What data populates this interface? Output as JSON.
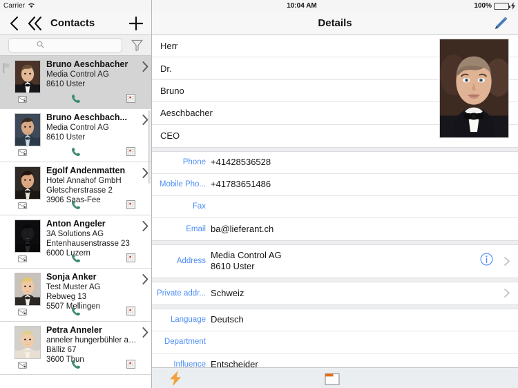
{
  "status_bar": {
    "carrier": "Carrier",
    "wifi_icon": "wifi-icon",
    "time": "10:04 AM",
    "battery_percent": "100%",
    "battery_icon": "battery-charging-icon",
    "battery_color": "#4cd964"
  },
  "left_pane": {
    "nav": {
      "back_icon": "chevron-left-icon",
      "back_all_icon": "chevron-double-left-icon",
      "title": "Contacts",
      "add_icon": "plus-icon"
    },
    "search": {
      "placeholder": "",
      "value": "",
      "search_icon": "search-icon",
      "filter_icon": "filter-funnel-icon"
    },
    "row_action_icons": {
      "mail": "mail-icon",
      "phone": "phone-icon",
      "calendar": "calendar-icon"
    },
    "phone_icon_color": "#3d8c72",
    "contacts": [
      {
        "name": "Bruno Aeschbacher",
        "company": "Media Control AG",
        "street": "",
        "city": "8610 Uster",
        "selected": true,
        "flagged": true,
        "flag_icon": "flag-icon",
        "chevron_icon": "chevron-right-icon",
        "avatar_name": "avatar-bruno-aeschbacher"
      },
      {
        "name": "Bruno Aeschbach...",
        "company": "Media Control AG",
        "street": "",
        "city": "8610 Uster",
        "selected": false,
        "flagged": false,
        "flag_icon": "flag-icon",
        "chevron_icon": "chevron-right-icon",
        "avatar_name": "avatar-bruno-aeschbach"
      },
      {
        "name": "Egolf Andenmatten",
        "company": "Hotel Annahof GmbH",
        "street": "Gletscherstrasse 2",
        "city": "3906 Saas-Fee",
        "selected": false,
        "flagged": false,
        "flag_icon": "flag-icon",
        "chevron_icon": "chevron-right-icon",
        "avatar_name": "avatar-egolf-andenmatten"
      },
      {
        "name": "Anton Angeler",
        "company": "3A Solutions AG",
        "street": "Entenhausenstrasse 23",
        "city": "6000 Luzern",
        "selected": false,
        "flagged": false,
        "flag_icon": "flag-icon",
        "chevron_icon": "chevron-right-icon",
        "avatar_name": "avatar-anton-angeler"
      },
      {
        "name": "Sonja Anker",
        "company": "Test Muster AG",
        "street": "Rebweg 13",
        "city": "5507 Mellingen",
        "selected": false,
        "flagged": false,
        "flag_icon": "flag-icon",
        "chevron_icon": "chevron-right-icon",
        "avatar_name": "avatar-sonja-anker"
      },
      {
        "name": "Petra Anneler",
        "company": "anneler hungerbühler ag...",
        "street": "Bälliz 67",
        "city": "3600 Thun",
        "selected": false,
        "flagged": false,
        "flag_icon": "flag-icon",
        "chevron_icon": "chevron-right-icon",
        "avatar_name": "avatar-petra-anneler"
      }
    ]
  },
  "right_pane": {
    "nav": {
      "title": "Details",
      "edit_icon": "pencil-edit-icon"
    },
    "name_fields": [
      {
        "value": "Herr"
      },
      {
        "value": "Dr."
      },
      {
        "value": "Bruno"
      },
      {
        "value": "Aeschbacher"
      },
      {
        "value": "CEO"
      }
    ],
    "portrait_name": "contact-portrait",
    "contact_fields": [
      {
        "label": "Phone",
        "value": "+41428536528"
      },
      {
        "label": "Mobile Pho...",
        "value": "+41783651486"
      },
      {
        "label": "Fax",
        "value": ""
      },
      {
        "label": "Email",
        "value": "ba@lieferant.ch"
      }
    ],
    "address_field": {
      "label": "Address",
      "line1": "Media Control AG",
      "line2": "8610 Uster",
      "info_icon": "info-circle-icon",
      "chevron_icon": "chevron-right-icon"
    },
    "private_address_field": {
      "label": "Private addr...",
      "value": "Schweiz",
      "chevron_icon": "chevron-right-icon"
    },
    "extra_fields": [
      {
        "label": "Language",
        "value": "Deutsch"
      },
      {
        "label": "Department",
        "value": ""
      },
      {
        "label": "Influence",
        "value": "Entscheider"
      }
    ],
    "bottom_bar": {
      "bolt_icon": "lightning-bolt-icon",
      "bolt_color": "#f0a23c",
      "note_icon": "note-folder-icon",
      "note_color": "#e06c19"
    }
  },
  "theme": {
    "label_blue": "#4d8ef7",
    "phone_green": "#3d8c72",
    "nav_bg": "#f7f7f7",
    "selected_row": "#d4d4d4"
  }
}
